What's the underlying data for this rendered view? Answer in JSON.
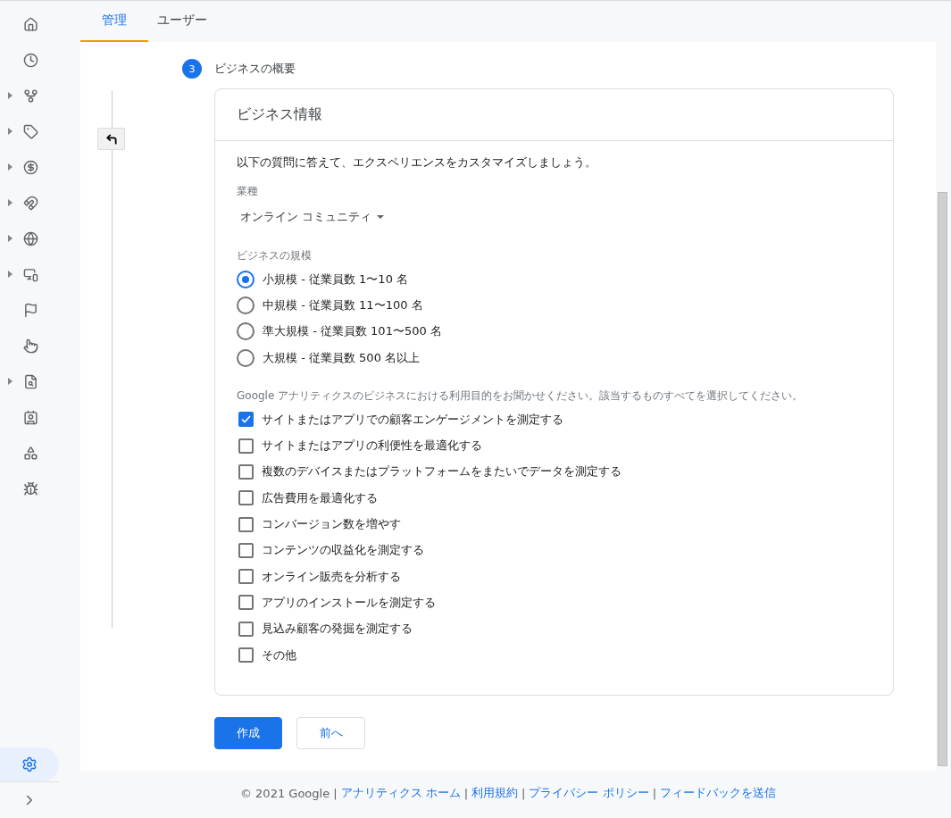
{
  "sidebar": {
    "items": [
      {
        "expandable": false,
        "selected": false
      },
      {
        "expandable": false,
        "selected": false
      },
      {
        "expandable": true,
        "selected": false
      },
      {
        "expandable": true,
        "selected": false
      },
      {
        "expandable": true,
        "selected": false
      },
      {
        "expandable": true,
        "selected": false
      },
      {
        "expandable": true,
        "selected": false
      },
      {
        "expandable": true,
        "selected": false
      },
      {
        "expandable": false,
        "selected": false
      },
      {
        "expandable": false,
        "selected": false
      },
      {
        "expandable": true,
        "selected": false
      },
      {
        "expandable": false,
        "selected": false
      },
      {
        "expandable": false,
        "selected": false
      },
      {
        "expandable": false,
        "selected": false
      }
    ],
    "settings": {
      "selected": true
    }
  },
  "tabs": [
    {
      "label": "管理",
      "selected": true
    },
    {
      "label": "ユーザー",
      "selected": false
    }
  ],
  "step": {
    "number": "3",
    "title": "ビジネスの概要"
  },
  "card": {
    "title": "ビジネス情報",
    "intro": "以下の質問に答えて、エクスペリエンスをカスタマイズしましょう。",
    "industry": {
      "label": "業種",
      "value": "オンライン コミュニティ"
    },
    "size": {
      "label": "ビジネスの規模",
      "options": [
        {
          "label": "小規模 - 従業員数 1〜10 名",
          "selected": true
        },
        {
          "label": "中規模 - 従業員数 11〜100 名",
          "selected": false
        },
        {
          "label": "準大規模 - 従業員数 101〜500 名",
          "selected": false
        },
        {
          "label": "大規模 - 従業員数 500 名以上",
          "selected": false
        }
      ]
    },
    "purpose": {
      "label": "Google アナリティクスのビジネスにおける利用目的をお聞かせください。該当するものすべてを選択してください。",
      "options": [
        {
          "label": "サイトまたはアプリでの顧客エンゲージメントを測定する",
          "checked": true
        },
        {
          "label": "サイトまたはアプリの利便性を最適化する",
          "checked": false
        },
        {
          "label": "複数のデバイスまたはプラットフォームをまたいでデータを測定する",
          "checked": false
        },
        {
          "label": "広告費用を最適化する",
          "checked": false
        },
        {
          "label": "コンバージョン数を増やす",
          "checked": false
        },
        {
          "label": "コンテンツの収益化を測定する",
          "checked": false
        },
        {
          "label": "オンライン販売を分析する",
          "checked": false
        },
        {
          "label": "アプリのインストールを測定する",
          "checked": false
        },
        {
          "label": "見込み顧客の発掘を測定する",
          "checked": false
        },
        {
          "label": "その他",
          "checked": false
        }
      ]
    }
  },
  "buttons": [
    {
      "kind": "primary",
      "label": "作成"
    },
    {
      "kind": "secondary",
      "label": "前へ"
    }
  ],
  "footer": {
    "items": [
      {
        "kind": "text",
        "text": "© 2021 Google"
      },
      {
        "kind": "separator",
        "text": "|"
      },
      {
        "kind": "link",
        "text": "アナリティクス ホーム"
      },
      {
        "kind": "separator",
        "text": "|"
      },
      {
        "kind": "link",
        "text": "利用規約"
      },
      {
        "kind": "separator",
        "text": "|"
      },
      {
        "kind": "link",
        "text": "プライバシー ポリシー"
      },
      {
        "kind": "separator",
        "text": "|"
      },
      {
        "kind": "link",
        "text": "フィードバックを送信"
      }
    ]
  }
}
